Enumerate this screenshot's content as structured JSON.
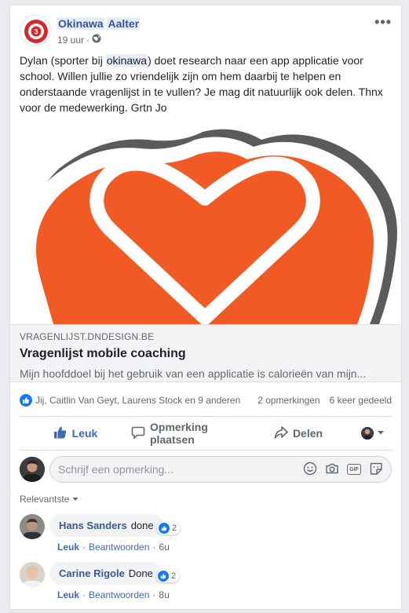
{
  "post": {
    "page_name_part1": "Okinawa",
    "page_name_part2": "Aalter",
    "time": "19 uur",
    "separator": "·",
    "text_part1": "Dylan (sporter bij ",
    "text_highlight": "okinawa",
    "text_part2": ") doet research naar een app applicatie voor school. Willen jullie zo vriendelijk zijn om hem daarbij te helpen en onderstaande vragenlijst in te vullen? Je mag dit natuurlijk ook delen. Thnx voor de medewerking. Grtn Jo"
  },
  "link": {
    "domain": "VRAGENLIJST.DNDESIGN.BE",
    "title": "Vragenlijst mobile coaching",
    "description": "Mijn hoofddoel bij het gebruik van een applicatie is calorieën van mijn..."
  },
  "reactions": {
    "reactors": "Jij, Caitlin Van Geyt, Laurens Stock en 9 anderen",
    "comments_count": "2 opmerkingen",
    "shares_count": "6 keer gedeeld"
  },
  "actions": {
    "like": "Leuk",
    "comment": "Opmerking plaatsen",
    "share": "Delen"
  },
  "comment_box": {
    "placeholder": "Schrijf een opmerking...",
    "gif_label": "GIF"
  },
  "sort": {
    "label": "Relevantste"
  },
  "comments": [
    {
      "author": "Hans Sanders",
      "text": "done",
      "reactions": "2",
      "like": "Leuk",
      "reply": "Beantwoorden",
      "time": "6u"
    },
    {
      "author": "Carine Rigole",
      "text": "Done",
      "reactions": "2",
      "like": "Leuk",
      "reply": "Beantwoorden",
      "time": "8u"
    }
  ],
  "colors": {
    "brand_orange": "#f15a24",
    "link_blue": "#365899",
    "like_blue": "#1877f2"
  },
  "icons": {
    "more": "more-dots-icon",
    "globe": "globe-icon",
    "thumbs_up": "thumbs-up-icon",
    "comment": "comment-icon",
    "share": "share-icon",
    "emoji": "emoji-icon",
    "camera": "camera-icon",
    "gif": "gif-icon",
    "sticker": "sticker-icon"
  }
}
